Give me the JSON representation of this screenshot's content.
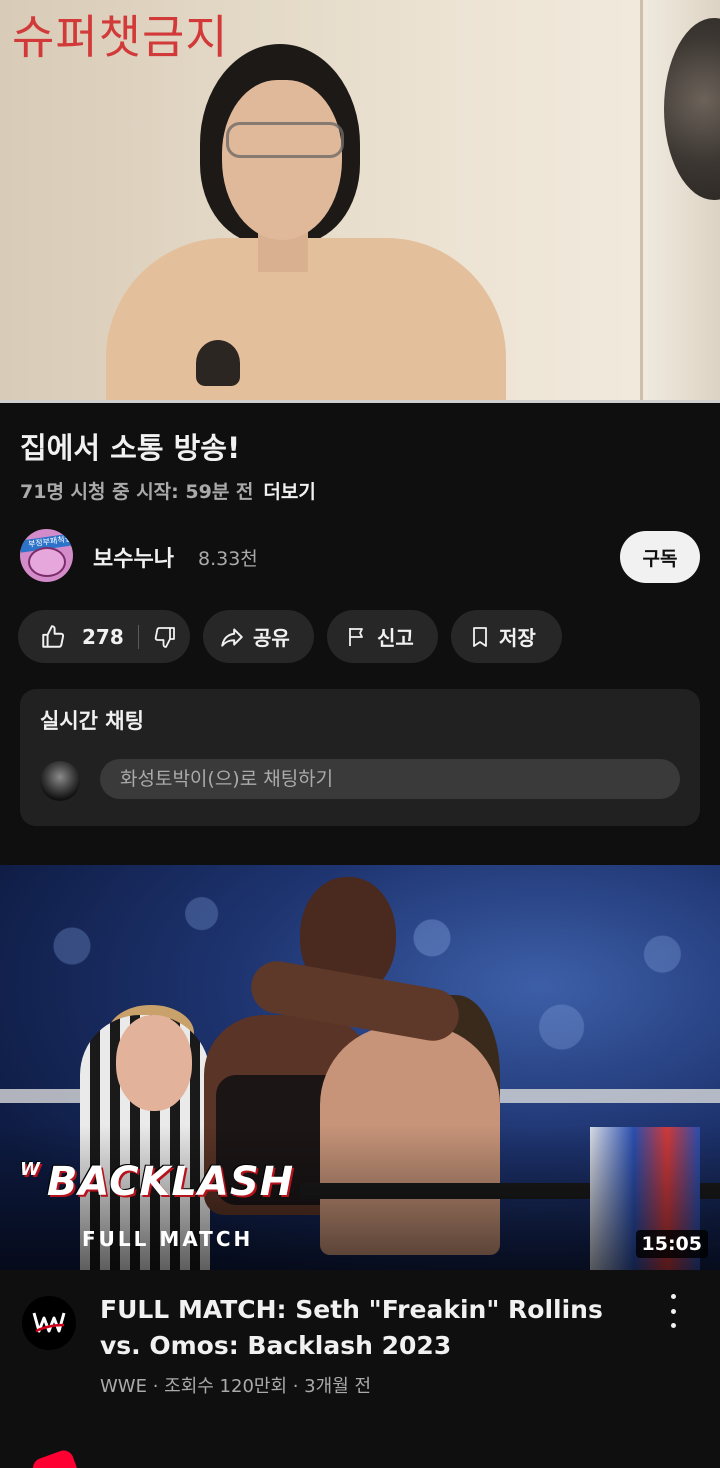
{
  "player": {
    "overlay_text": "슈퍼챗금지"
  },
  "video": {
    "title": "집에서 소통 방송!",
    "meta": "71명 시청 중  시작: 59분 전",
    "more_label": "더보기"
  },
  "channel": {
    "name": "보수누나",
    "subscribers": "8.33천",
    "avatar_text": "부정부패척결",
    "subscribe_label": "구독"
  },
  "actions": {
    "like_count": "278",
    "share_label": "공유",
    "report_label": "신고",
    "save_label": "저장"
  },
  "chat": {
    "title": "실시간 채팅",
    "input_placeholder": "화성토박이(으)로 채팅하기"
  },
  "recommended": {
    "thumbnail_title": "BACKLASH",
    "thumbnail_wwe": "W",
    "thumbnail_subtitle": "FULL MATCH",
    "duration": "15:05",
    "title": "FULL MATCH: Seth \"Freakin\" Rollins vs. Omos: Backlash 2023",
    "meta": "WWE · 조회수 120만회 · 3개월 전"
  },
  "colors": {
    "background": "#0f0f0f",
    "pill": "#272727",
    "chat_card": "#212121",
    "subscribe_bg": "#f1f1f1",
    "wwe_red": "#b5121b"
  },
  "icons": [
    "thumbs-up-icon",
    "thumbs-down-icon",
    "share-icon",
    "flag-icon",
    "bookmark-icon",
    "more-vert-icon",
    "wwe-logo-icon"
  ]
}
